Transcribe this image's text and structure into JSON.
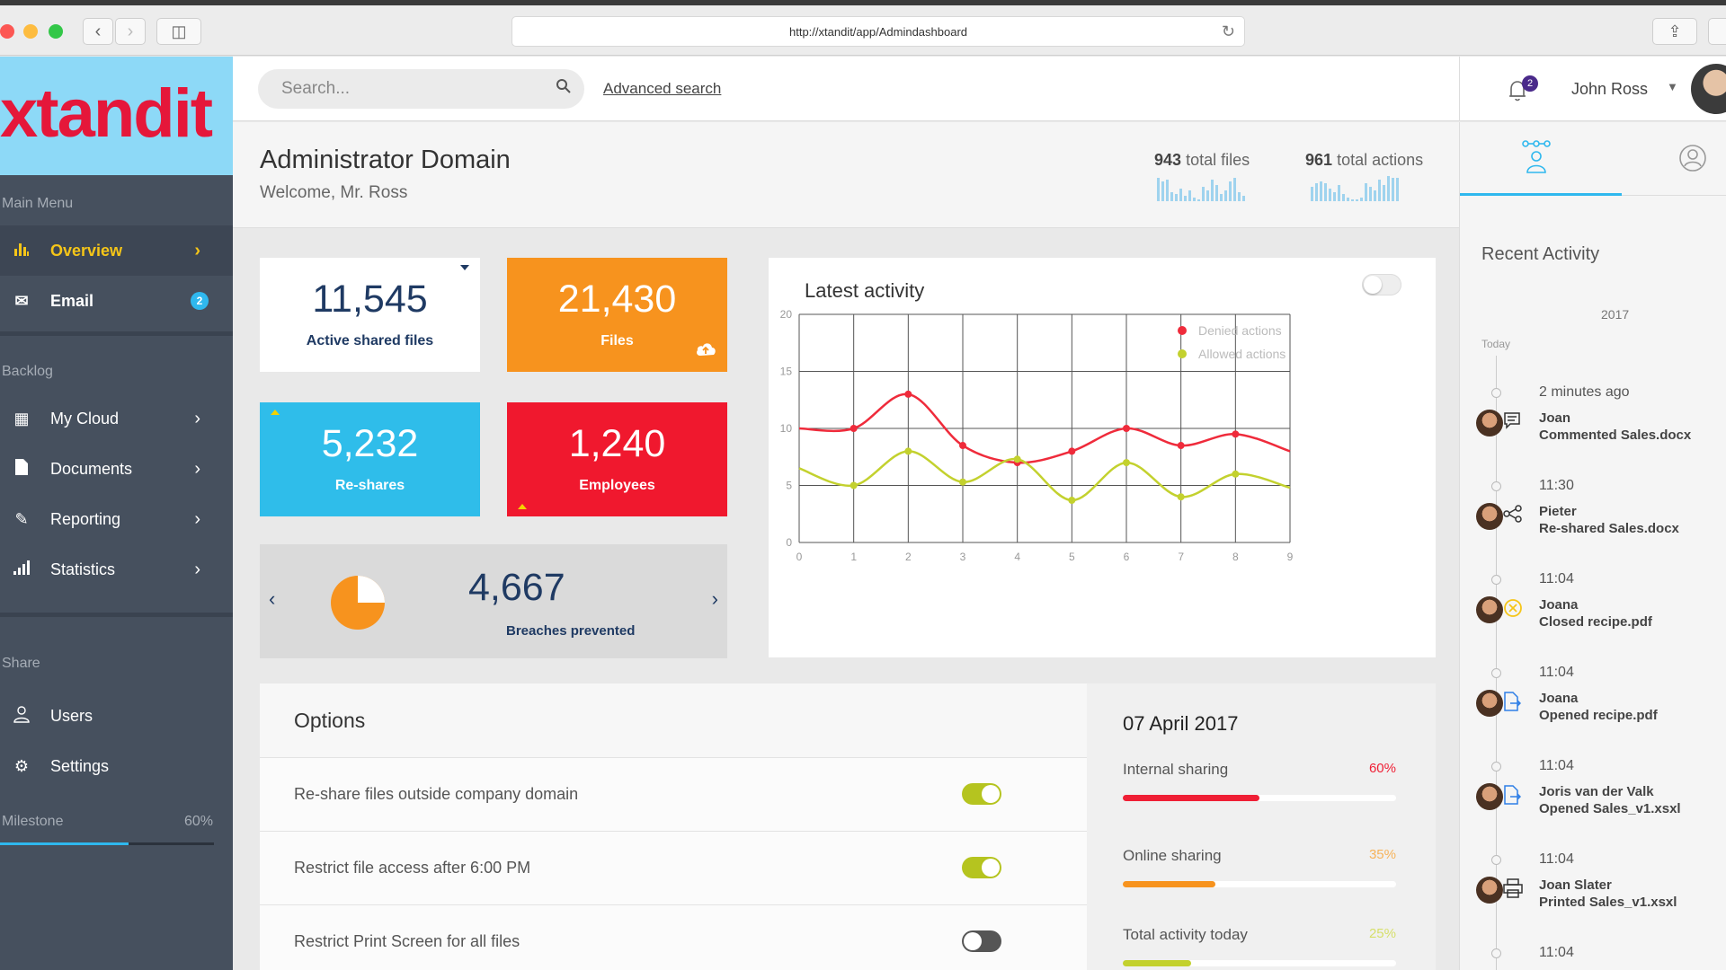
{
  "browser": {
    "url": "http://xtandit/app/Admindashboard",
    "back_icon": "‹",
    "forward_icon": "›",
    "sidebar_toggle_icon": "◫",
    "share_icon": "⇪",
    "reload_icon": "↻"
  },
  "brand": {
    "logo_text": "xtandit"
  },
  "sidebar": {
    "main_menu_label": "Main Menu",
    "main_items": [
      {
        "label": "Overview",
        "icon": "bar-chart-icon"
      },
      {
        "label": "Email",
        "icon": "envelope-icon",
        "badge": "2"
      }
    ],
    "backlog_label": "Backlog",
    "backlog_items": [
      {
        "label": "My Cloud"
      },
      {
        "label": "Documents"
      },
      {
        "label": "Reporting"
      },
      {
        "label": "Statistics"
      }
    ],
    "share_label": "Share",
    "share_items": [
      {
        "label": "Users"
      },
      {
        "label": "Settings"
      }
    ],
    "milestone": {
      "label": "Milestone",
      "percent_text": "60%",
      "progress": 0.6
    }
  },
  "topbar": {
    "search_placeholder": "Search...",
    "advanced_search": "Advanced search",
    "notification_count": "2",
    "user_name": "John Ross"
  },
  "header": {
    "title": "Administrator Domain",
    "welcome": "Welcome, Mr. Ross",
    "total_files_num": "943",
    "total_files_label": "total files",
    "total_actions_num": "961",
    "total_actions_label": "total actions"
  },
  "tiles": {
    "active_shared": {
      "value": "11,545",
      "label": "Active shared files"
    },
    "files": {
      "value": "21,430",
      "label": "Files"
    },
    "reshares": {
      "value": "5,232",
      "label": "Re-shares"
    },
    "employees": {
      "value": "1,240",
      "label": "Employees"
    },
    "breaches": {
      "value": "4,667",
      "label": "Breaches prevented"
    }
  },
  "chart_data": {
    "type": "line",
    "title": "Latest activity",
    "x": [
      0,
      1,
      2,
      3,
      4,
      5,
      6,
      7,
      8,
      9
    ],
    "xlim": [
      0,
      9
    ],
    "ylim": [
      0,
      20
    ],
    "yticks": [
      0,
      5,
      10,
      15,
      20
    ],
    "grid": true,
    "legend_position": "top-right",
    "series": [
      {
        "name": "Denied actions",
        "color": "#ef2b3b",
        "values": [
          10,
          10,
          13,
          8.5,
          7,
          8,
          10,
          8.5,
          9.5,
          8
        ]
      },
      {
        "name": "Allowed actions",
        "color": "#c3d12e",
        "values": [
          6.5,
          5,
          8,
          5.3,
          7.3,
          3.7,
          7,
          4,
          6,
          4.8
        ]
      }
    ]
  },
  "options": {
    "title": "Options",
    "items": [
      {
        "label": "Re-share files outside company domain",
        "enabled": true
      },
      {
        "label": "Restrict file access after 6:00 PM",
        "enabled": true
      },
      {
        "label": "Restrict Print Screen for all files",
        "enabled": false
      }
    ]
  },
  "date_card": {
    "date": "07 April 2017",
    "bars": [
      {
        "label": "Internal sharing",
        "percent_text": "60%",
        "value": 0.5,
        "color": "#ef1f35"
      },
      {
        "label": "Online sharing",
        "percent_text": "35%",
        "value": 0.34,
        "color": "#f7931e"
      },
      {
        "label": "Total activity today",
        "percent_text": "25%",
        "value": 0.25,
        "color": "#c3d12e"
      }
    ]
  },
  "recent": {
    "title": "Recent Activity",
    "year": "2017",
    "today_label": "Today",
    "items": [
      {
        "time": "2 minutes ago",
        "name": "Joan",
        "action": "Commented Sales.docx",
        "icon": "comment-icon"
      },
      {
        "time": "11:30",
        "name": "Pieter",
        "action": "Re-shared Sales.docx",
        "icon": "share-icon"
      },
      {
        "time": "11:04",
        "name": "Joana",
        "action": "Closed recipe.pdf",
        "icon": "close-circle-icon"
      },
      {
        "time": "11:04",
        "name": "Joana",
        "action": "Opened recipe.pdf",
        "icon": "document-open-icon"
      },
      {
        "time": "11:04",
        "name": "Joris van der Valk",
        "action": "Opened Sales_v1.xsxl",
        "icon": "document-open-icon"
      },
      {
        "time": "11:04",
        "name": "Joan Slater",
        "action": "Printed Sales_v1.xsxl",
        "icon": "printer-icon"
      },
      {
        "time": "11:04"
      }
    ]
  }
}
